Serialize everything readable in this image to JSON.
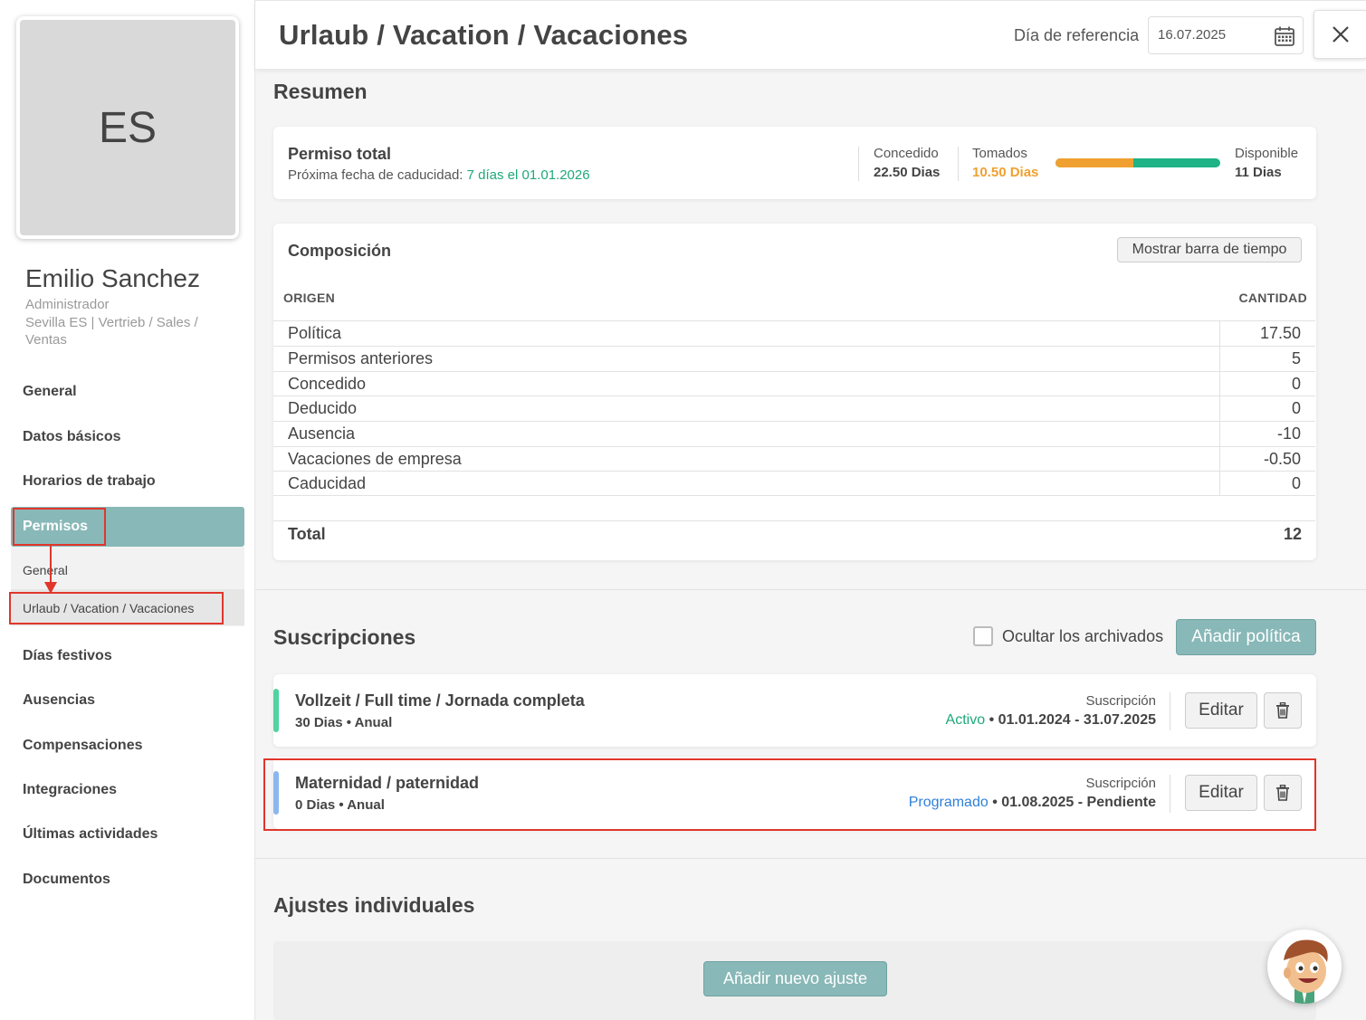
{
  "profile": {
    "initials": "ES",
    "name": "Emilio Sanchez",
    "role": "Administrador",
    "department": "Sevilla ES | Vertrieb / Sales / Ventas"
  },
  "sidebar": {
    "items": [
      {
        "label": "General"
      },
      {
        "label": "Datos básicos"
      },
      {
        "label": "Horarios de trabajo"
      },
      {
        "label": "Permisos"
      },
      {
        "label": "Días festivos"
      },
      {
        "label": "Ausencias"
      },
      {
        "label": "Compensaciones"
      },
      {
        "label": "Integraciones"
      },
      {
        "label": "Últimas actividades"
      },
      {
        "label": "Documentos"
      }
    ],
    "subitems": [
      {
        "label": "General"
      },
      {
        "label": "Urlaub / Vacation / Vacaciones"
      }
    ]
  },
  "header": {
    "title": "Urlaub / Vacation / Vacaciones",
    "ref_label": "Día de referencia",
    "ref_date": "16.07.2025"
  },
  "summary": {
    "section_title": "Resumen",
    "title": "Permiso total",
    "expiry_prefix": "Próxima fecha de caducidad:",
    "expiry_value": "7 días el 01.01.2026",
    "granted_label": "Concedido",
    "granted_value": "22.50 Dias",
    "taken_label": "Tomados",
    "taken_value": "10.50 Dias",
    "available_label": "Disponible",
    "available_value": "11 Dias",
    "taken_fraction": 0.47
  },
  "composition": {
    "title": "Composición",
    "timeline_button": "Mostrar barra de tiempo",
    "col_origin": "ORIGEN",
    "col_amount": "CANTIDAD",
    "rows": [
      {
        "label": "Política",
        "value": "17.50"
      },
      {
        "label": "Permisos anteriores",
        "value": "5"
      },
      {
        "label": "Concedido",
        "value": "0"
      },
      {
        "label": "Deducido",
        "value": "0"
      },
      {
        "label": "Ausencia",
        "value": "-10"
      },
      {
        "label": "Vacaciones de empresa",
        "value": "-0.50"
      },
      {
        "label": "Caducidad",
        "value": "0"
      }
    ],
    "total_label": "Total",
    "total_value": "12"
  },
  "subscriptions": {
    "section_title": "Suscripciones",
    "hide_archived_label": "Ocultar los archivados",
    "add_policy_button": "Añadir política",
    "items": [
      {
        "name": "Vollzeit / Full time / Jornada completa",
        "meta": "30 Dias • Anual",
        "label": "Suscripción",
        "status": "Activo",
        "period": " • 01.01.2024 - 31.07.2025",
        "edit": "Editar"
      },
      {
        "name": "Maternidad / paternidad",
        "meta": "0 Dias • Anual",
        "label": "Suscripción",
        "status": "Programado",
        "period": " • 01.08.2025 - Pendiente",
        "edit": "Editar"
      }
    ]
  },
  "adjustments": {
    "section_title": "Ajustes individuales",
    "add_button": "Añadir nuevo ajuste"
  },
  "colors": {
    "teal": "#88b8b7",
    "green": "#1fa87a",
    "orange": "#f0a030",
    "blue": "#2f80d8",
    "highlight": "#e0362c"
  },
  "icons": [
    "calendar-icon",
    "close-icon",
    "trash-icon",
    "support-mascot-icon"
  ]
}
